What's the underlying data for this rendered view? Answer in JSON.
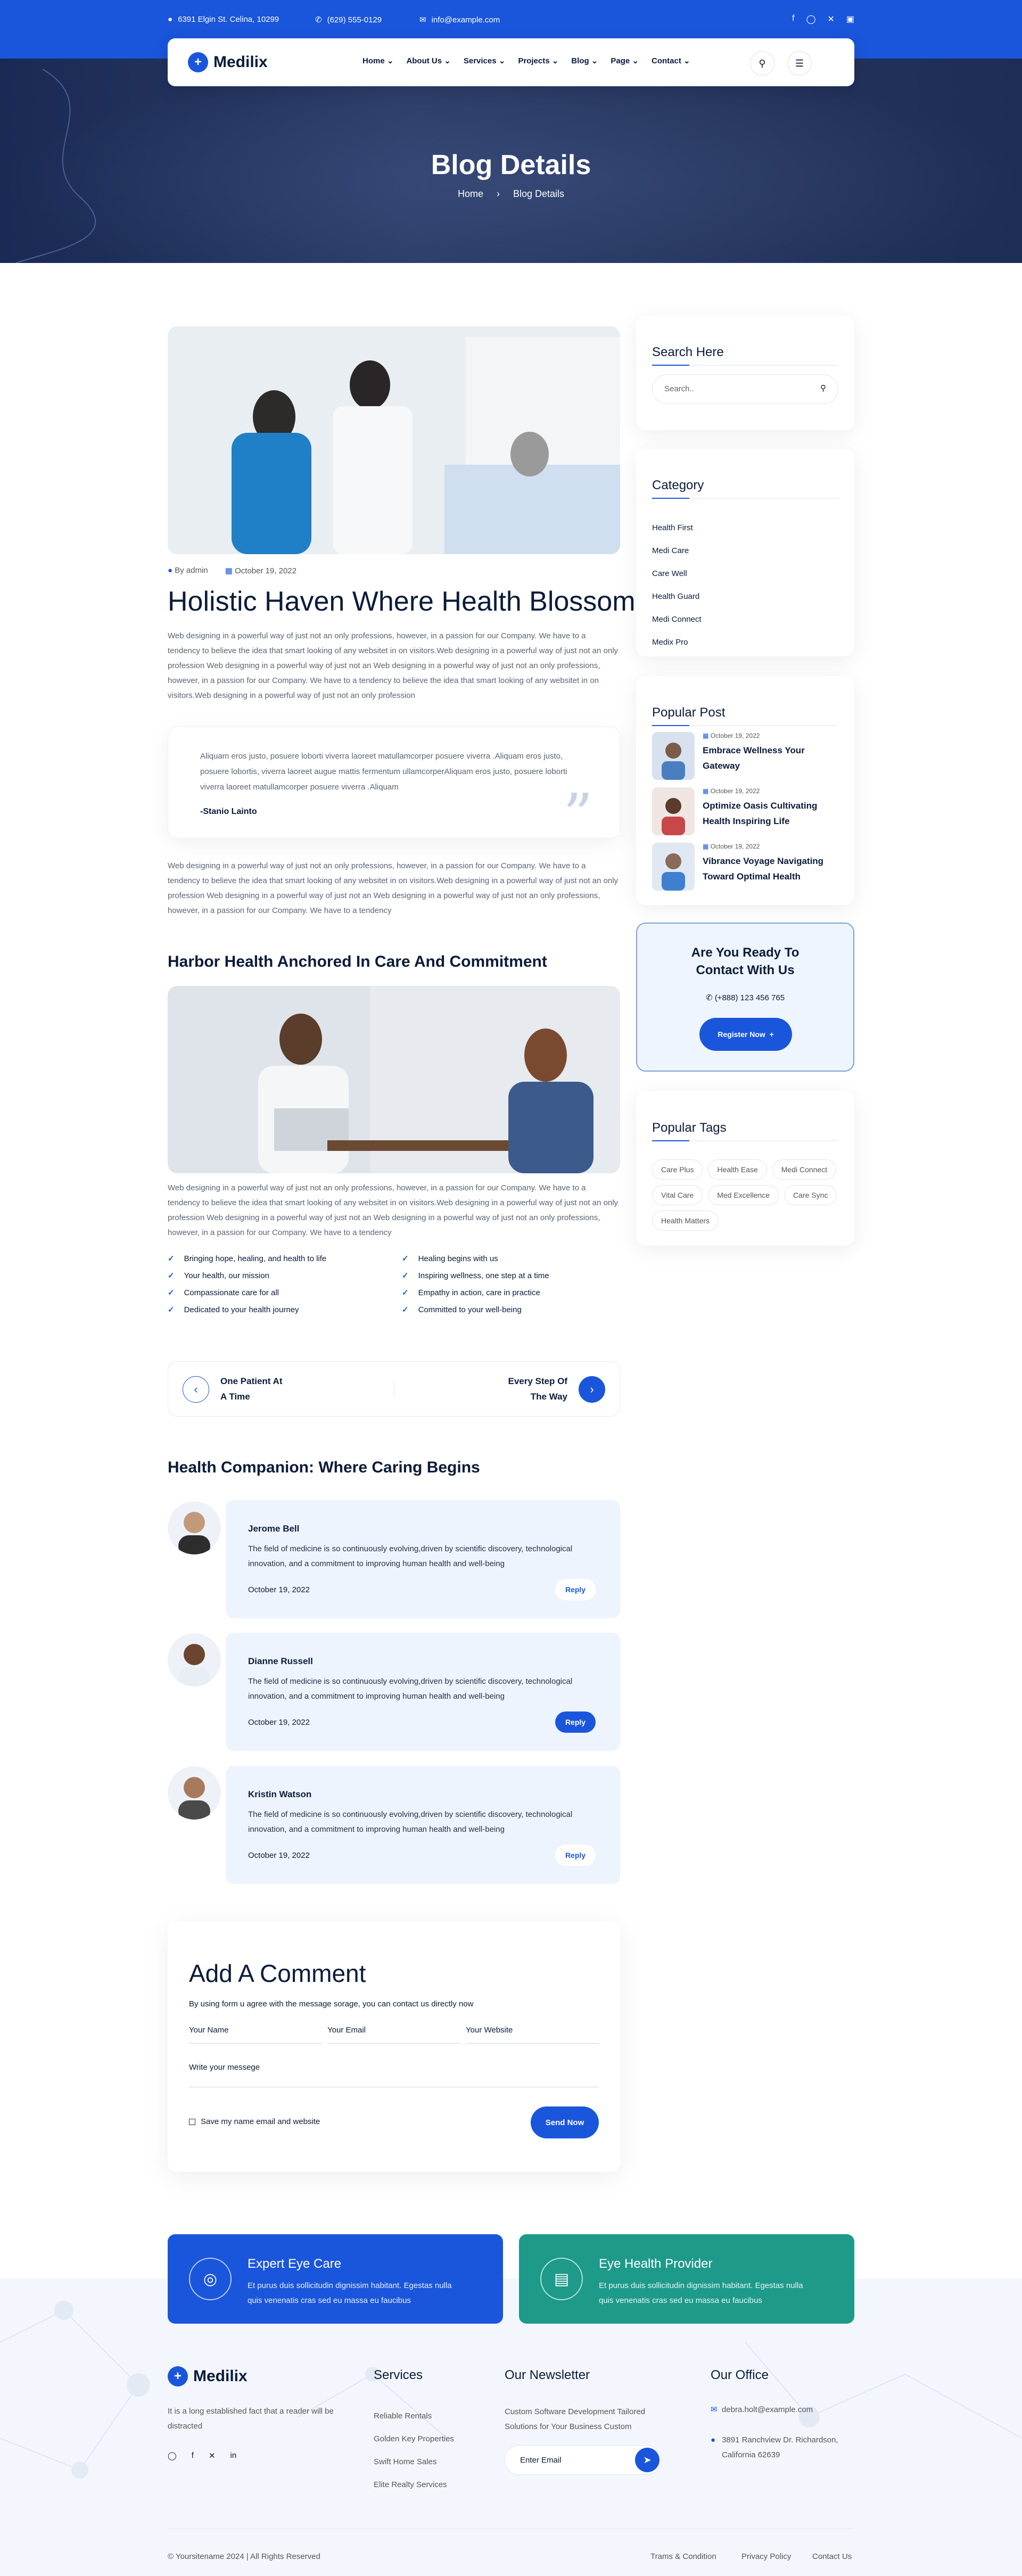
{
  "topbar": {
    "address": "6391 Elgin St. Celina, 10299",
    "phone": "(629) 555-0129",
    "email": "info@example.com"
  },
  "nav": {
    "brand": "Medilix",
    "items": [
      "Home",
      "About Us",
      "Services",
      "Projects",
      "Blog",
      "Page",
      "Contact"
    ]
  },
  "hero": {
    "title": "Blog Details",
    "crumb_home": "Home",
    "crumb_current": "Blog Details"
  },
  "post": {
    "author": "By admin",
    "date": "October 19, 2022",
    "title": "Holistic Haven Where Health Blossoms",
    "intro": "Web designing in a powerful way of just not an only professions, however, in a passion for our Company. We have to a tendency to believe the idea that smart looking of any websitet in on visitors.Web designing in a powerful way of just not an only profession Web designing in a powerful way of just not an Web designing in a powerful way of just not an only professions, however, in a passion for our Company. We have to a tendency to believe the idea that smart looking of any websitet in on visitors.Web designing in a powerful way of just not an only profession",
    "quote": "Aliquam eros justo, posuere loborti viverra laoreet matullamcorper posuere viverra .Aliquam eros justo, posuere lobortis, viverra laoreet augue mattis fermentum ullamcorperAliquam eros justo, posuere loborti viverra laoreet matullamcorper posuere viverra .Aliquam",
    "quote_author": "-Stanio Lainto",
    "para2": "Web designing in a powerful way of just not an only professions, however, in a passion for our Company. We have to a tendency to believe the idea that smart looking of any websitet in on visitors.Web designing in a powerful way of just not an only profession Web designing in a powerful way of just not an Web designing in a powerful way of just not an only professions, however, in a passion for our Company. We have to a tendency",
    "subtitle": "Harbor Health Anchored In Care And Commitment",
    "para3": "Web designing in a powerful way of just not an only professions, however, in a passion for our Company. We have to a tendency to believe the idea that smart looking of any websitet in on visitors.Web designing in a powerful way of just not an only profession Web designing in a powerful way of just not an Web designing in a powerful way of just not an only professions, however, in a passion for our Company. We have to a tendency",
    "checks": [
      "Bringing hope, healing, and health to life",
      "Healing begins with us",
      "Your health, our mission",
      "Inspiring wellness, one step at a time",
      "Compassionate care for all",
      "Empathy in action, care in practice",
      "Dedicated to your health journey",
      "Committed to your well-being"
    ],
    "prev": [
      "One Patient At",
      "A Time"
    ],
    "next": [
      "Every Step Of",
      "The Way"
    ]
  },
  "comments": {
    "title": "Health Companion: Where Caring Begins",
    "items": [
      {
        "name": "Jerome Bell",
        "text": "The field of medicine is so continuously evolving,driven by scientific discovery, technological innovation, and a commitment to improving human health and well-being",
        "date": "October 19, 2022",
        "reply": "Reply"
      },
      {
        "name": "Dianne Russell",
        "text": "The field of medicine is so continuously evolving,driven by scientific discovery, technological innovation, and a commitment to improving human health and well-being",
        "date": "October 19, 2022",
        "reply": "Reply"
      },
      {
        "name": "Kristin Watson",
        "text": "The field of medicine is so continuously evolving,driven by scientific discovery, technological innovation, and a commitment to improving human health and well-being",
        "date": "October 19, 2022",
        "reply": "Reply"
      }
    ]
  },
  "form": {
    "title": "Add A Comment",
    "subtitle": "By using form u agree with the message sorage, you can contact us directly now",
    "name": "Your Name",
    "email": "Your Email",
    "website": "Your Website",
    "message": "Write your messege",
    "save": "Save my name email and website",
    "send": "Send Now"
  },
  "sidebar": {
    "search_title": "Search Here",
    "search_placeholder": "Search..",
    "category_title": "Category",
    "categories": [
      "Health First",
      "Medi Care",
      "Care Well",
      "Health Guard",
      "Medi Connect",
      "Medix Pro"
    ],
    "popular_title": "Popular Post",
    "popular": [
      {
        "date": "October 19, 2022",
        "title": "Embrace Wellness Your Gateway"
      },
      {
        "date": "October 19, 2022",
        "title": "Optimize Oasis Cultivating Health Inspiring Life"
      },
      {
        "date": "October 19, 2022",
        "title": "Vibrance Voyage Navigating Toward Optimal Health"
      }
    ],
    "cta_title": "Are You Ready To Contact With Us",
    "cta_phone": "(+888) 123 456 765",
    "cta_button": "Register Now",
    "tags_title": "Popular Tags",
    "tags": [
      "Care Plus",
      "Health Ease",
      "Medi Connect",
      "Vital Care",
      "Med Excellence",
      "Care Sync",
      "Health Matters"
    ]
  },
  "footer": {
    "card1_title": "Expert Eye Care",
    "card1_text": "Et purus duis sollicitudin dignissim habitant. Egestas nulla quis venenatis cras sed eu massa eu faucibus",
    "card2_title": "Eye Health Provider",
    "card2_text": "Et purus duis sollicitudin dignissim habitant. Egestas nulla quis venenatis cras sed eu massa eu faucibus",
    "brand": "Medilix",
    "about": "It is a long established fact that a reader will be distracted",
    "services_title": "Services",
    "services": [
      "Reliable Rentals",
      "Golden Key Properties",
      "Swift Home Sales",
      "Elite Realty Services"
    ],
    "news_title": "Our Newsletter",
    "news_text": "Custom Software Development Tailored Solutions for Your Business Custom",
    "news_placeholder": "Enter Email",
    "office_title": "Our Office",
    "office_email": "debra.holt@example.com",
    "office_address": "3891 Ranchview Dr. Richardson, California 62639",
    "copyright": "© Yoursitename 2024 | All Rights Reserved",
    "links": [
      "Trams & Condition",
      "Privacy Policy",
      "Contact Us"
    ]
  },
  "colors": {
    "accent": "#1a56db",
    "teal": "#1d9a8a",
    "dark": "#0b1b3a"
  }
}
